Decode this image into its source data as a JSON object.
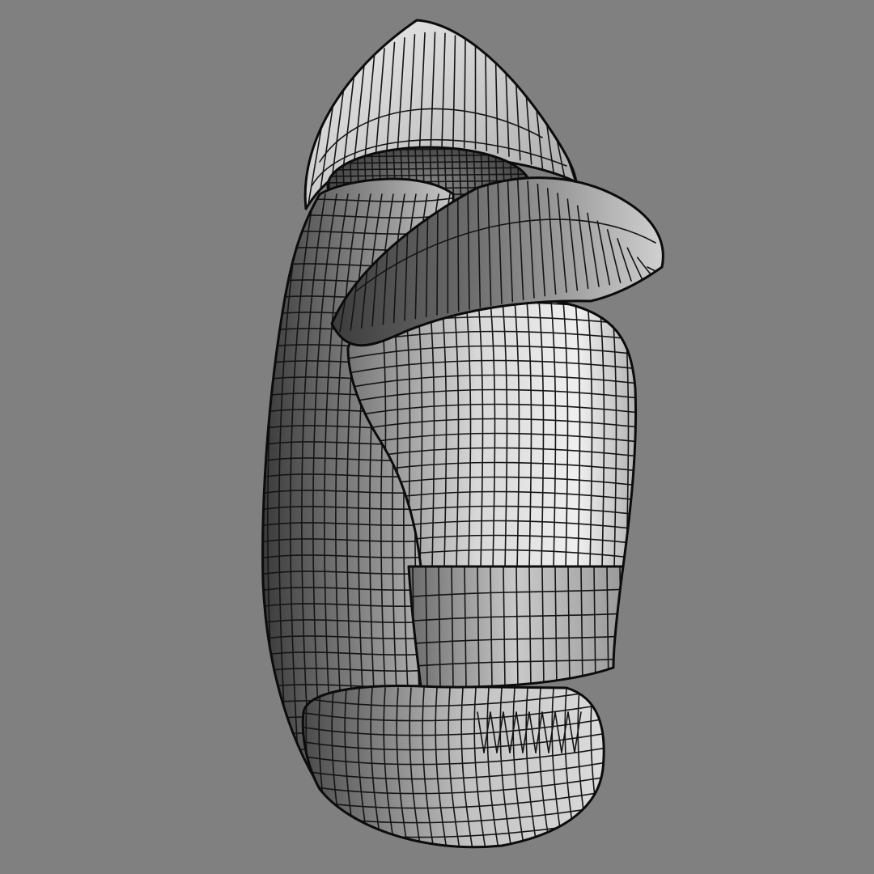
{
  "viewport": {
    "background_color": "#808080",
    "display_mode": "shaded-wireframe",
    "wire_color": "#141414",
    "object": "3d-mesh-capped-sleeved-figure"
  }
}
